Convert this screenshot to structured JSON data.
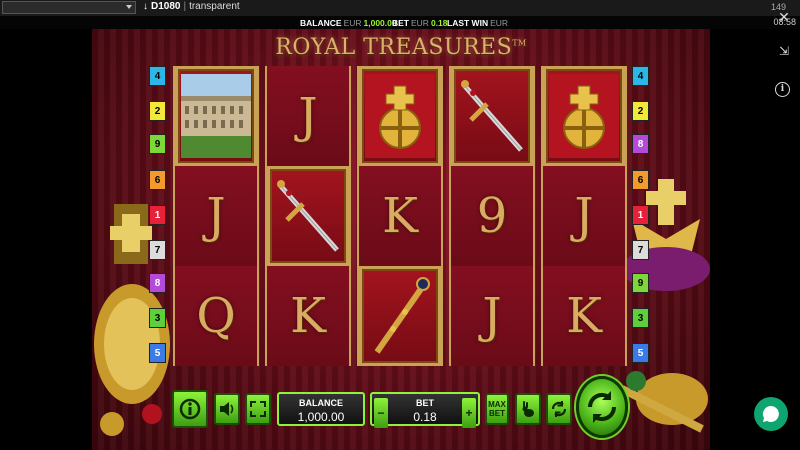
{
  "debug_bar": {
    "dropdown_value": "",
    "build": "D1080",
    "separator": "|",
    "mode": "transparent",
    "fps": "149",
    "clock": "08:58"
  },
  "info_strip": {
    "balance_label": "BALANCE",
    "balance_currency": "EUR",
    "balance_value": "1,000.00",
    "bet_label": "BET",
    "bet_currency": "EUR",
    "bet_value": "0.18",
    "last_win_label": "LAST WIN",
    "last_win_currency": "EUR"
  },
  "game": {
    "title": "ROYAL TREASURES",
    "trademark": "TM",
    "reels": [
      [
        "palace",
        "J",
        "Q"
      ],
      [
        "J",
        "sword",
        "K"
      ],
      [
        "orb",
        "K",
        "scepter"
      ],
      [
        "sword",
        "9",
        "J"
      ],
      [
        "orb",
        "J",
        "K"
      ]
    ],
    "paylines_left": [
      "4",
      "2",
      "9",
      "6",
      "1",
      "7",
      "8",
      "3",
      "5"
    ],
    "paylines_right": [
      "4",
      "2",
      "8",
      "6",
      "1",
      "7",
      "9",
      "3",
      "5"
    ],
    "payline_colors": {
      "1": "#e8213a",
      "2": "#f2e83a",
      "3": "#5dcf3a",
      "4": "#2bb8e8",
      "5": "#3a7be8",
      "6": "#f29a2b",
      "7": "#dcdcdc",
      "8": "#b44bd8",
      "9": "#7fd63a"
    }
  },
  "controls": {
    "info_icon": "info-icon",
    "sound_icon": "speaker-icon",
    "fullscreen_icon": "fullscreen-icon",
    "balance_label": "BALANCE",
    "balance_value": "1,000.00",
    "bet_label": "BET",
    "bet_value": "0.18",
    "minus": "−",
    "plus": "+",
    "max_bet_line1": "MAX",
    "max_bet_line2": "BET",
    "turbo_icon": "rabbit-icon",
    "autoplay_icon": "autoplay-icon",
    "spin_icon": "spin-icon"
  },
  "side": {
    "close": "✕",
    "collapse": "⇲",
    "info": "i"
  }
}
